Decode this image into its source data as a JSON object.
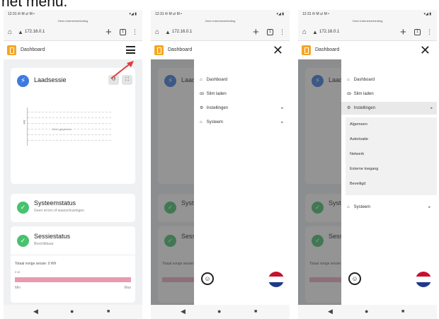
{
  "caption": "het menu.",
  "statusbar": {
    "time": "12:31 ✉ M ⇄ M •",
    "signal": "▾◢ ▮"
  },
  "netbar": {
    "text": "Geen internetverbinding"
  },
  "urlbar": {
    "url": "172.16.0.1",
    "home_icon": "home-icon",
    "plus": "+",
    "tabs_count": "1",
    "menu_icon": "⋮"
  },
  "appbar": {
    "title": "Dashboard"
  },
  "laadsessie": {
    "title": "Laadsessie",
    "empty_text": "Geen gegevens",
    "y_label": "kW",
    "chart_data": {
      "type": "line",
      "series": [],
      "grid": true
    }
  },
  "systeemstatus": {
    "title": "Systeemstatus",
    "subtitle": "Geen errors of waarschuwingen"
  },
  "sessiestatus": {
    "title": "Sessiestatus",
    "subtitle": "Beschikbaar",
    "vorige_label": "Totaal vorige sessie: 0 Wh",
    "zero_label": "0 W",
    "min_label": "Min",
    "max_label": "Max",
    "progress": 1.0
  },
  "menu": {
    "items": [
      {
        "label": "Dashboard",
        "icon": "⌂"
      },
      {
        "label": "Slim laden",
        "icon": "ꝏ"
      },
      {
        "label": "Instellingen",
        "icon": "⚙",
        "arrow": "▸"
      },
      {
        "label": "Systeem",
        "icon": "⌂",
        "arrow": "▸"
      }
    ],
    "submenu": [
      "Algemeen",
      "Autorisatie",
      "Netwerk",
      "Externe toegang",
      "Beveiligd"
    ]
  },
  "colors": {
    "accent_orange": "#f5a623",
    "blue": "#3d7be0",
    "green": "#47c26f",
    "pink": "#e89ab1",
    "arrow_red": "#e23b3b"
  }
}
